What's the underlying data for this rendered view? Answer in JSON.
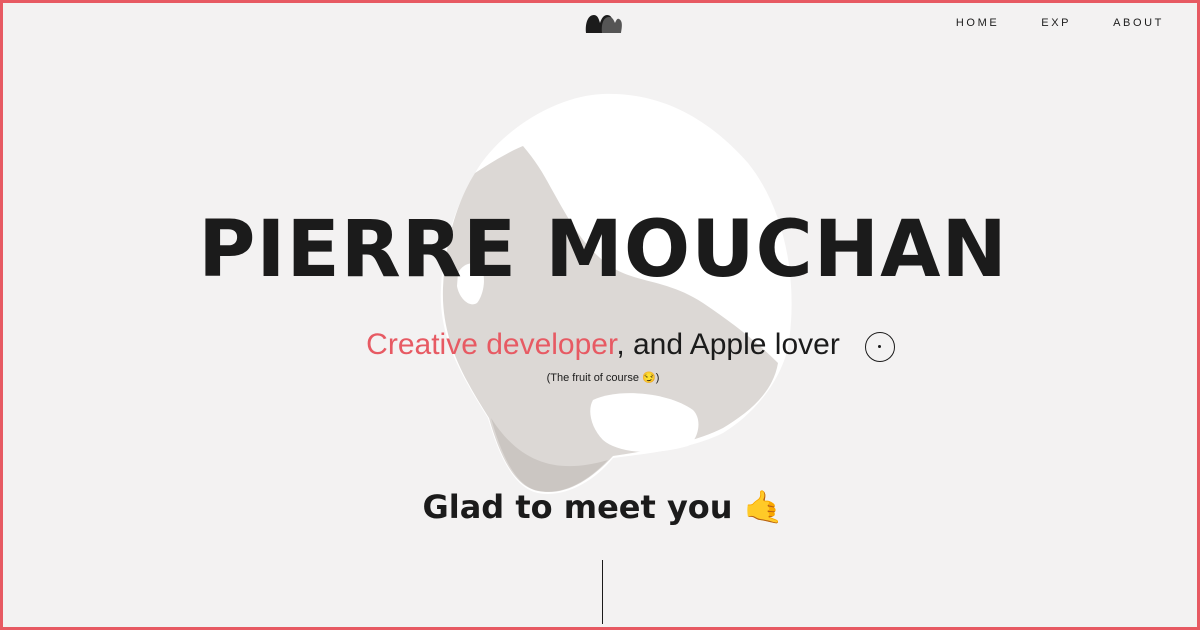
{
  "nav": {
    "home": "HOME",
    "exp": "EXP",
    "about": "ABOUT",
    "active": "about"
  },
  "hero": {
    "title": "PIERRE MOUCHAN",
    "tagline_accent": "Creative developer",
    "tagline_rest": ", and Apple lover",
    "note_text": "(The fruit of course ",
    "note_emoji": "😏",
    "note_close": ")"
  },
  "greeting": {
    "text": "Glad to meet you",
    "emoji": "🤙"
  },
  "colors": {
    "accent": "#e75a63",
    "background": "#f3f2f2",
    "text": "#1b1b1b"
  },
  "icons": {
    "logo": "mm-logo-icon",
    "cursor": "cursor-circle-icon"
  }
}
